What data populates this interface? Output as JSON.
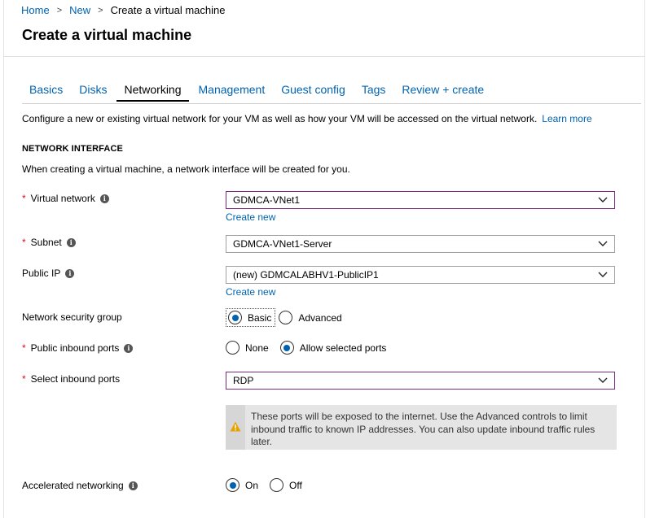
{
  "breadcrumb": {
    "home": "Home",
    "new": "New",
    "current": "Create a virtual machine",
    "separator": ">"
  },
  "page": {
    "title": "Create a virtual machine"
  },
  "tabs": [
    {
      "label": "Basics",
      "active": false
    },
    {
      "label": "Disks",
      "active": false
    },
    {
      "label": "Networking",
      "active": true
    },
    {
      "label": "Management",
      "active": false
    },
    {
      "label": "Guest config",
      "active": false
    },
    {
      "label": "Tags",
      "active": false
    },
    {
      "label": "Review + create",
      "active": false
    }
  ],
  "intro": {
    "text": "Configure a new or existing virtual network for your VM as well as how your VM will be accessed on the virtual network.",
    "link": "Learn more"
  },
  "network_interface": {
    "header": "NETWORK INTERFACE",
    "description": "When creating a virtual machine, a network interface will be created for you."
  },
  "fields": {
    "virtual_network": {
      "label": "Virtual network",
      "required": "*",
      "value": "GDMCA-VNet1",
      "create_new": "Create new"
    },
    "subnet": {
      "label": "Subnet",
      "required": "*",
      "value": "GDMCA-VNet1-Server"
    },
    "public_ip": {
      "label": "Public IP",
      "value": "(new) GDMCALABHV1-PublicIP1",
      "create_new": "Create new"
    },
    "nsg": {
      "label": "Network security group",
      "options": [
        "Basic",
        "Advanced"
      ],
      "selected": "Basic"
    },
    "public_inbound_ports": {
      "label": "Public inbound ports",
      "required": "*",
      "options": [
        "None",
        "Allow selected ports"
      ],
      "selected": "Allow selected ports"
    },
    "select_inbound_ports": {
      "label": "Select inbound ports",
      "required": "*",
      "value": "RDP"
    },
    "accelerated_networking": {
      "label": "Accelerated networking",
      "options": [
        "On",
        "Off"
      ],
      "selected": "On"
    }
  },
  "warning": {
    "text": "These ports will be exposed to the internet. Use the Advanced controls to limit inbound traffic to known IP addresses. You can also update inbound traffic rules later."
  },
  "icons": {
    "info": "info-icon",
    "chevron": "chevron-down-icon",
    "warning": "warning-icon"
  },
  "colors": {
    "link": "#0063b1",
    "required": "#e00b1c",
    "warning": "#e8a200",
    "focus_border": "#7a2a7a"
  }
}
